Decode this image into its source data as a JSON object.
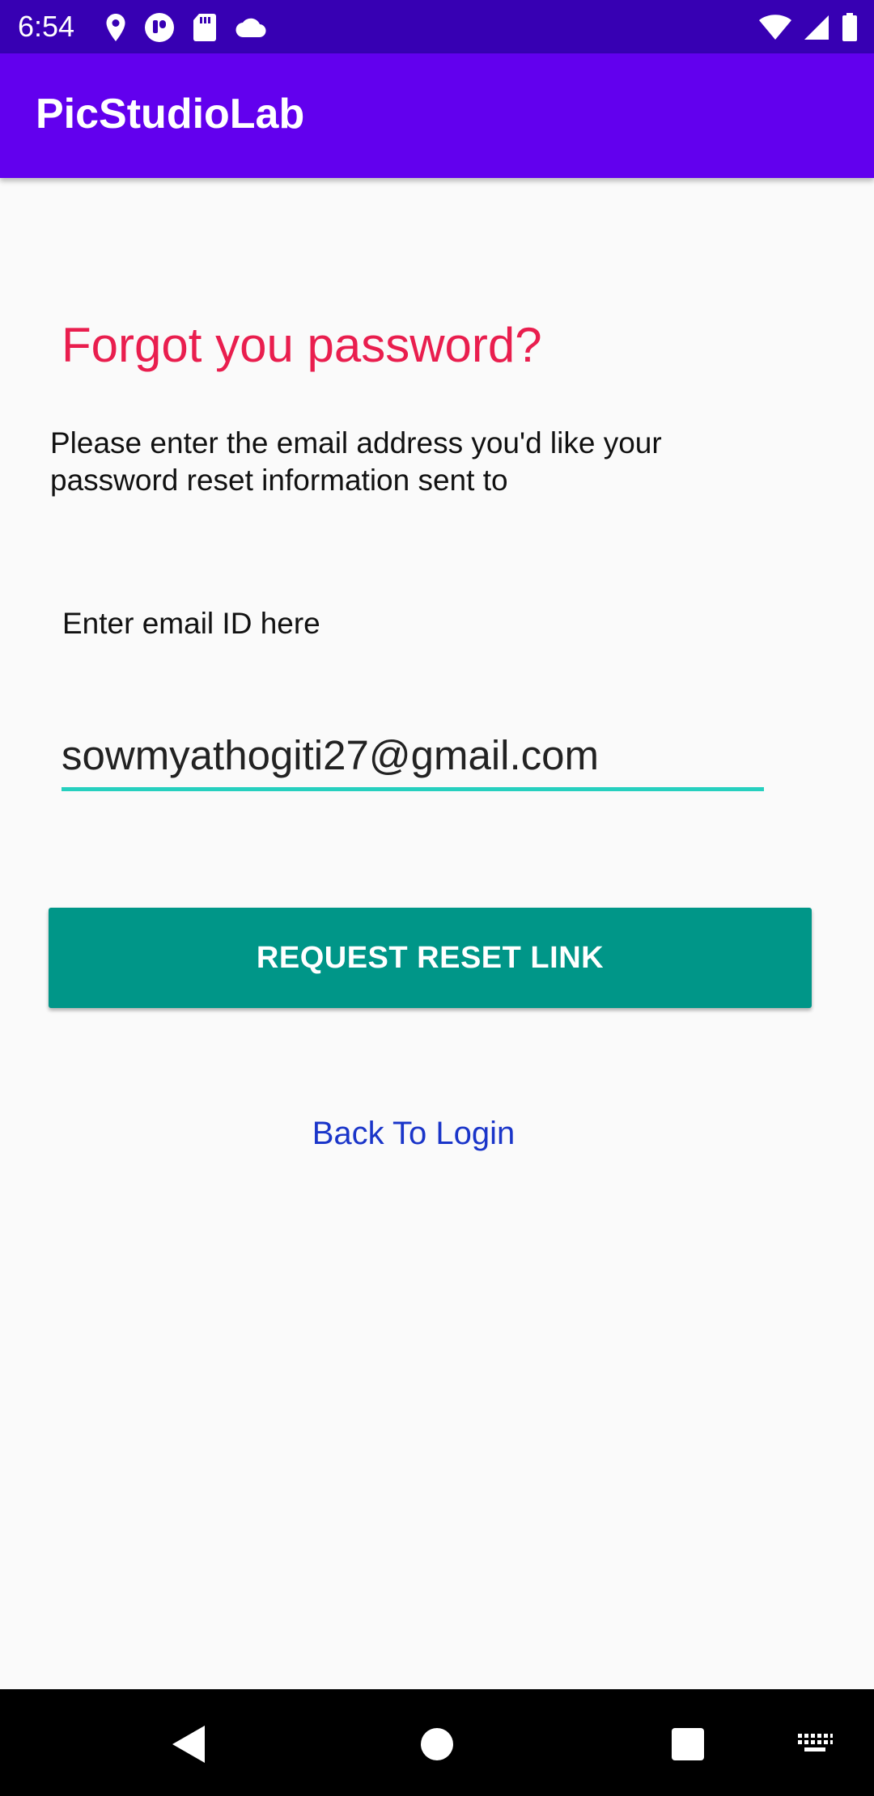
{
  "status_bar": {
    "time": "6:54",
    "left_icons": [
      "location-icon",
      "app-notification-icon",
      "sd-card-icon",
      "cloud-icon"
    ],
    "right_icons": [
      "wifi-icon",
      "signal-icon",
      "battery-icon"
    ]
  },
  "app_bar": {
    "title": "PicStudioLab"
  },
  "form": {
    "heading": "Forgot you password?",
    "instructions": "Please enter the email address you'd like your password reset information sent to",
    "email_label": "Enter email ID here",
    "email_value": "sowmyathogiti27@gmail.com",
    "submit_label": "REQUEST RESET LINK",
    "back_link": "Back To Login"
  },
  "nav_bar": {
    "buttons": [
      "back-icon",
      "home-icon",
      "recents-icon",
      "keyboard-icon"
    ]
  },
  "colors": {
    "status_bar": "#3700b3",
    "app_bar": "#6200ee",
    "heading": "#e91e4e",
    "button": "#009688",
    "input_underline": "#26d0bf",
    "link": "#1a35c9"
  }
}
